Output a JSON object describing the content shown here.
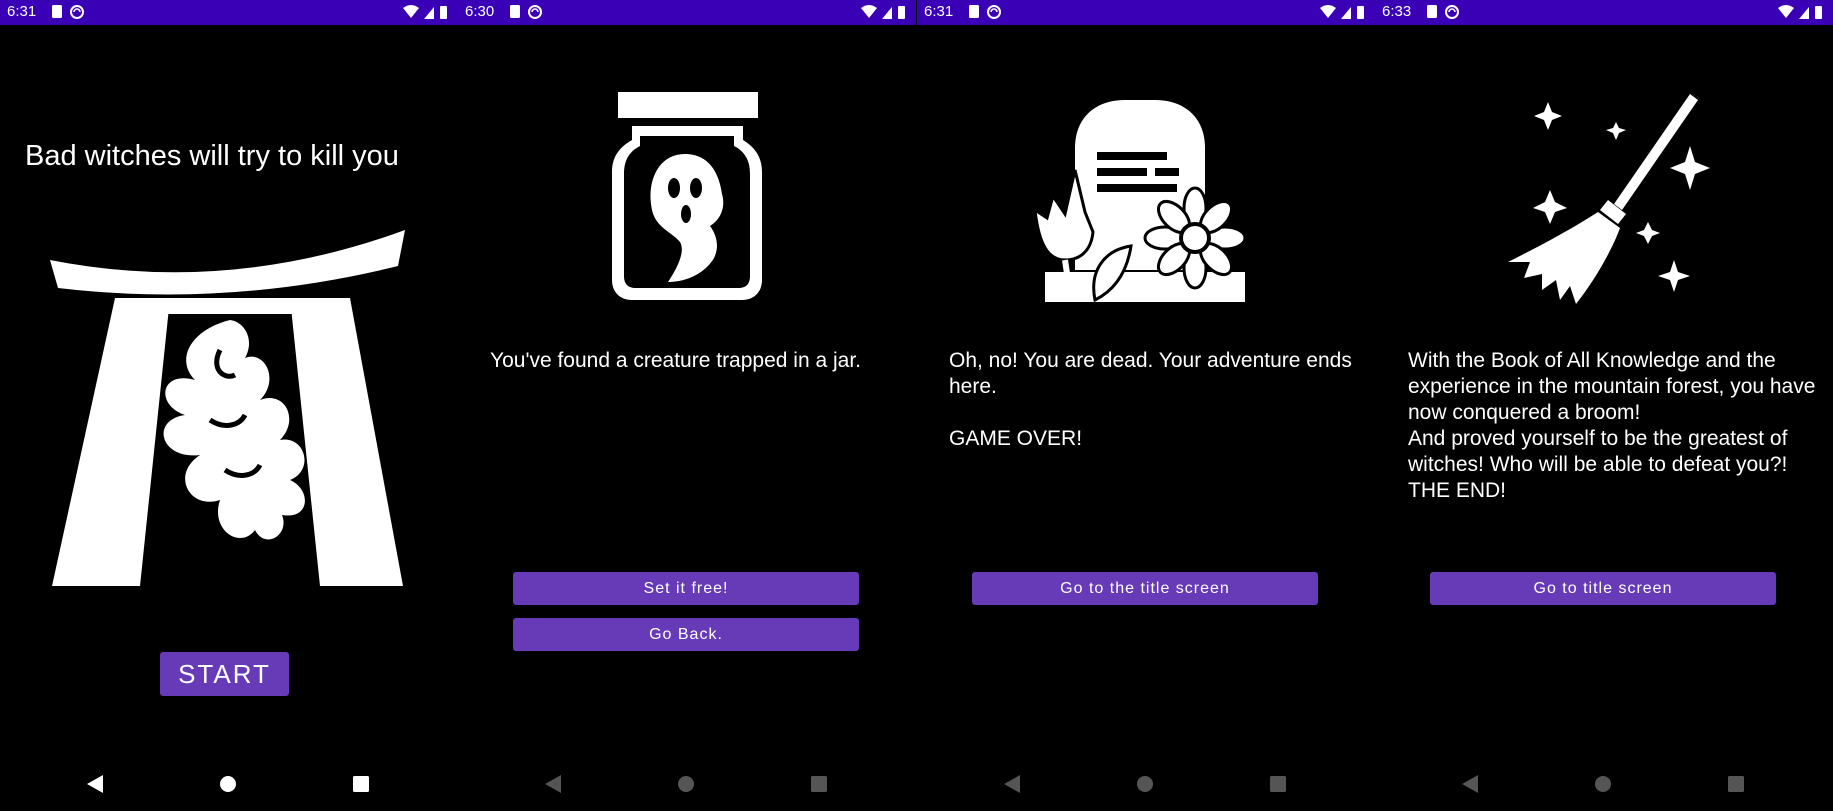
{
  "colors": {
    "status_bar": "#3a00b6",
    "button": "#673ab7",
    "background": "#000000",
    "text": "#ffffff"
  },
  "screens": [
    {
      "status_time": "6:31",
      "headline": "Bad witches will try to kill you",
      "illustration_icon": "torii-gate-spirit-icon",
      "start_label": "START"
    },
    {
      "status_time": "6:30",
      "illustration_icon": "ghost-jar-icon",
      "message": "You've found a creature trapped in a jar.",
      "buttons": [
        "Set it free!",
        "Go Back."
      ]
    },
    {
      "status_time": "6:31",
      "illustration_icon": "grave-flowers-icon",
      "message": "Oh, no! You are dead. Your adventure ends here.\n\nGAME OVER!",
      "buttons": [
        "Go to the title screen"
      ]
    },
    {
      "status_time": "6:33",
      "illustration_icon": "magic-broom-icon",
      "message": "With the Book of All Knowledge and the experience in the mountain forest, you have now conquered a broom!\nAnd proved yourself to be the greatest of witches! Who will be able to defeat you?!\nTHE END!",
      "buttons": [
        "Go to title screen"
      ]
    }
  ]
}
